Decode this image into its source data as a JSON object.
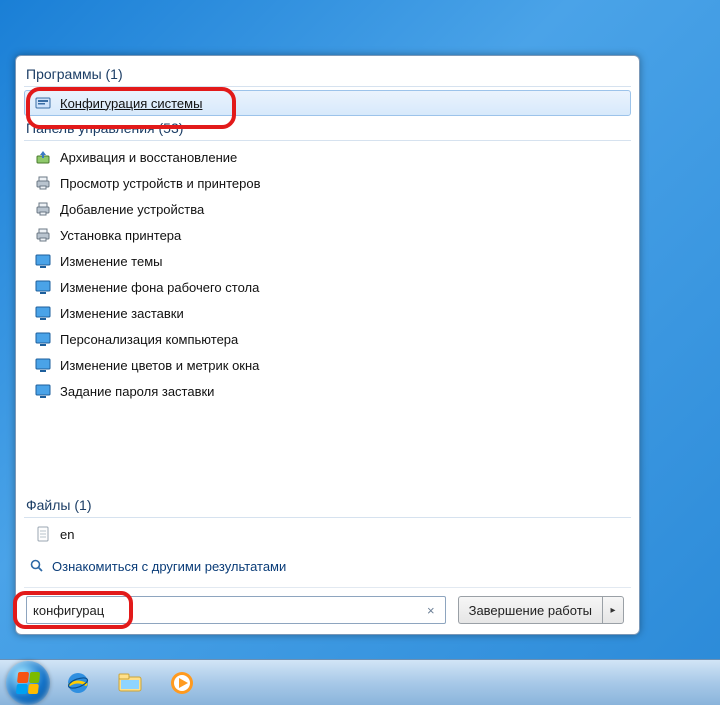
{
  "sections": {
    "programs": {
      "title": "Программы (1)"
    },
    "control_panel": {
      "title": "Панель управления (53)"
    },
    "files": {
      "title": "Файлы (1)"
    }
  },
  "programs": [
    {
      "label": "Конфигурация системы",
      "icon": "msconfig-icon"
    }
  ],
  "control_panel": [
    {
      "label": "Архивация и восстановление",
      "icon": "backup-icon"
    },
    {
      "label": "Просмотр устройств и принтеров",
      "icon": "printer-icon"
    },
    {
      "label": "Добавление устройства",
      "icon": "printer-icon"
    },
    {
      "label": "Установка принтера",
      "icon": "printer-icon"
    },
    {
      "label": "Изменение темы",
      "icon": "theme-icon"
    },
    {
      "label": "Изменение фона рабочего стола",
      "icon": "theme-icon"
    },
    {
      "label": "Изменение заставки",
      "icon": "theme-icon"
    },
    {
      "label": "Персонализация компьютера",
      "icon": "theme-icon"
    },
    {
      "label": "Изменение цветов и метрик окна",
      "icon": "theme-icon"
    },
    {
      "label": "Задание пароля заставки",
      "icon": "theme-icon"
    }
  ],
  "files": [
    {
      "label": "en",
      "icon": "file-icon"
    }
  ],
  "see_more": "Ознакомиться с другими результатами",
  "search": {
    "value": "конфигурац",
    "clear_glyph": "×"
  },
  "shutdown": {
    "label": "Завершение работы",
    "arrow": "▸"
  },
  "taskbar": {
    "start": "start",
    "ie": "internet-explorer",
    "explorer": "file-explorer",
    "media": "media-player"
  }
}
